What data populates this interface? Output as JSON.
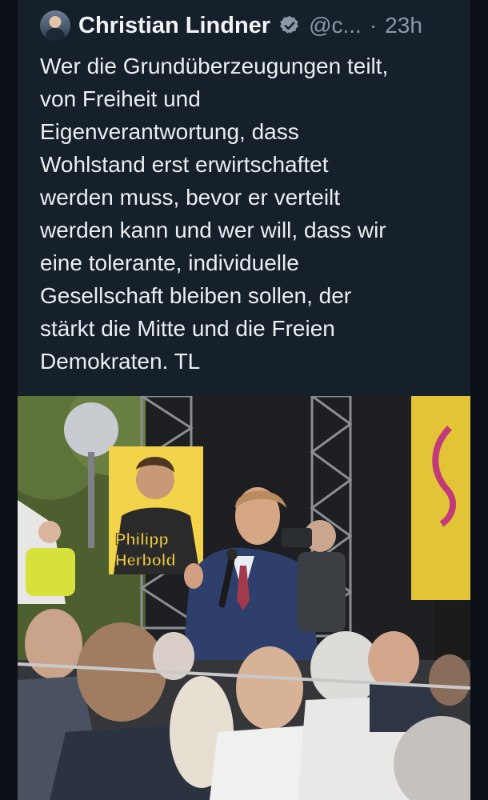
{
  "tweet": {
    "author_name": "Christian Lindner",
    "handle": "@c...",
    "separator": "·",
    "time": "23h",
    "verified": true,
    "avatar_icon": "profile-avatar",
    "text": "Wer die Grundüberzeugungen teilt,\nvon Freiheit und\nEigenverantwortung, dass\nWohlstand erst erwirtschaftet\nwerden muss, bevor er verteilt\nwerden kann und wer will, dass wir\neine tolerante, individuelle\nGesellschaft bleiben sollen, der\nstärkt die Mitte und die Freien\nDemokraten. TL"
  },
  "photo": {
    "poster_line1": "Philipp",
    "poster_line2": "Herbold"
  },
  "colors": {
    "background": "#15202b",
    "verified_badge": "#8b98a5",
    "poster_yellow": "#f4d348"
  }
}
